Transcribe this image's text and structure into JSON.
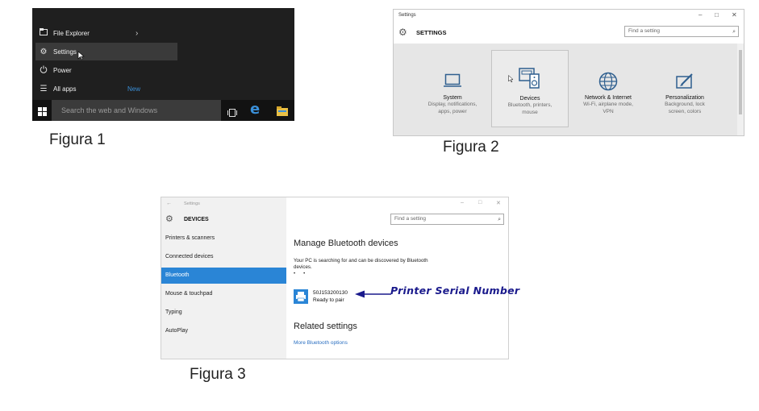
{
  "figure1": {
    "caption": "Figura 1",
    "menu_items": [
      {
        "label": "File Explorer",
        "icon": "folder-icon",
        "suffix": "›"
      },
      {
        "label": "Settings",
        "icon": "gear-icon"
      },
      {
        "label": "Power",
        "icon": "power-icon"
      },
      {
        "label": "All apps",
        "icon": "list-icon",
        "badge": "New"
      }
    ],
    "search_placeholder": "Search the web and Windows",
    "colors": {
      "background": "#1f1f1f",
      "taskbar": "#121212",
      "accent": "#3a8fd8"
    }
  },
  "figure2": {
    "caption": "Figura 2",
    "window_title": "Settings",
    "header_title": "SETTINGS",
    "search_placeholder": "Find a setting",
    "window_controls": [
      "–",
      "□",
      "✕"
    ],
    "tiles": [
      {
        "name": "System",
        "desc1": "Display, notifications,",
        "desc2": "apps, power",
        "icon": "laptop-icon"
      },
      {
        "name": "Devices",
        "desc1": "Bluetooth, printers,",
        "desc2": "mouse",
        "icon": "devices-icon"
      },
      {
        "name": "Network & Internet",
        "desc1": "Wi-Fi, airplane mode,",
        "desc2": "VPN",
        "icon": "globe-icon"
      },
      {
        "name": "Personalization",
        "desc1": "Background, lock",
        "desc2": "screen, colors",
        "icon": "paint-icon"
      }
    ]
  },
  "figure3": {
    "caption": "Figura 3",
    "window_title": "Settings",
    "header_title": "DEVICES",
    "search_placeholder": "Find a setting",
    "window_controls": [
      "–",
      "□",
      "✕"
    ],
    "nav_items": [
      "Printers & scanners",
      "Connected devices",
      "Bluetooth",
      "Mouse & touchpad",
      "Typing",
      "AutoPlay"
    ],
    "selected_nav": "Bluetooth",
    "main_title": "Manage Bluetooth devices",
    "searching_text_line1": "Your PC is searching for and can be discovered by Bluetooth",
    "searching_text_line2": "devices.",
    "device": {
      "name": "50J153200130",
      "status": "Ready to pair",
      "icon": "printer-icon"
    },
    "related_title": "Related settings",
    "related_link": "More Bluetooth options",
    "colors": {
      "selected": "#2a85d6",
      "link": "#2a6fc1"
    }
  },
  "annotation": {
    "label": "Printer Serial Number",
    "color": "#1a1a8c"
  }
}
